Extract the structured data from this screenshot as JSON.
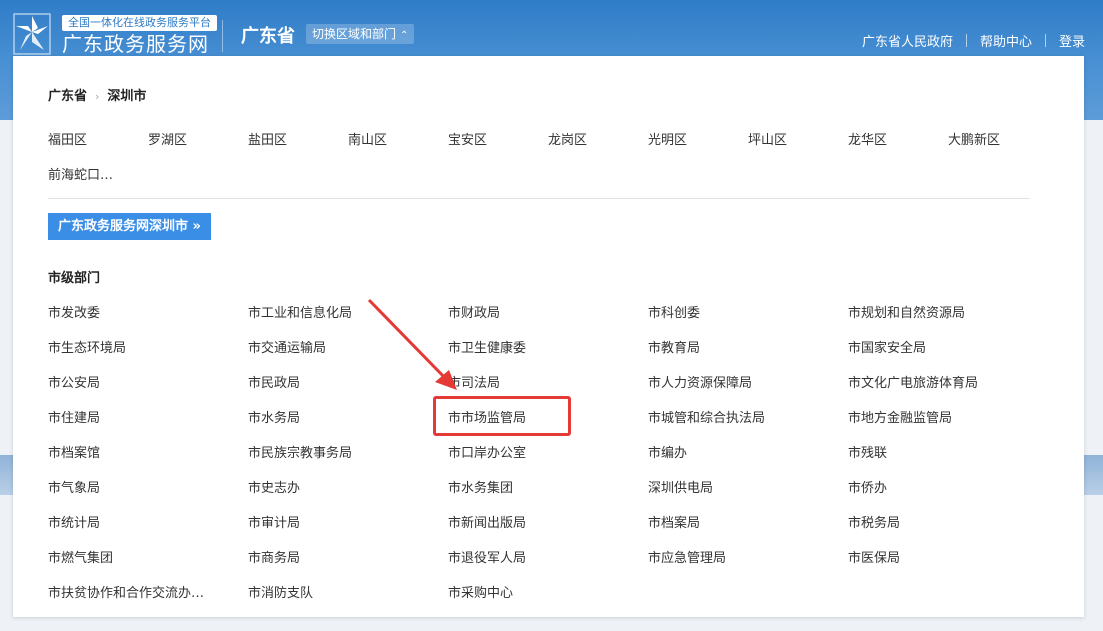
{
  "header": {
    "brand_tag": "全国一体化在线政务服务平台",
    "brand_name": "广东政务服务网",
    "province": "广东省",
    "switch_label": "切换区域和部门",
    "switch_icon": "chevron-up-icon",
    "links": [
      "广东省人民政府",
      "帮助中心",
      "登录"
    ]
  },
  "breadcrumb": {
    "items": [
      "广东省",
      "深圳市"
    ],
    "separator": "›"
  },
  "districts": [
    "福田区",
    "罗湖区",
    "盐田区",
    "南山区",
    "宝安区",
    "龙岗区",
    "光明区",
    "坪山区",
    "龙华区",
    "大鹏新区",
    "前海蛇口…"
  ],
  "city_button": "广东政务服务网深圳市 »",
  "departments_title": "市级部门",
  "departments": [
    [
      "市发改委",
      "市工业和信息化局",
      "市财政局",
      "市科创委",
      "市规划和自然资源局"
    ],
    [
      "市生态环境局",
      "市交通运输局",
      "市卫生健康委",
      "市教育局",
      "市国家安全局"
    ],
    [
      "市公安局",
      "市民政局",
      "市司法局",
      "市人力资源保障局",
      "市文化广电旅游体育局"
    ],
    [
      "市住建局",
      "市水务局",
      "市市场监管局",
      "市城管和综合执法局",
      "市地方金融监管局"
    ],
    [
      "市档案馆",
      "市民族宗教事务局",
      "市口岸办公室",
      "市编办",
      "市残联"
    ],
    [
      "市气象局",
      "市史志办",
      "市水务集团",
      "深圳供电局",
      "市侨办"
    ],
    [
      "市统计局",
      "市审计局",
      "市新闻出版局",
      "市档案局",
      "市税务局"
    ],
    [
      "市燃气集团",
      "市商务局",
      "市退役军人局",
      "市应急管理局",
      "市医保局"
    ],
    [
      "市扶贫协作和合作交流办…",
      "市消防支队",
      "市采购中心"
    ]
  ],
  "colors": {
    "header_blue": "#2f7cc7",
    "button_blue": "#3a8ee6",
    "highlight_red": "#e53935"
  }
}
